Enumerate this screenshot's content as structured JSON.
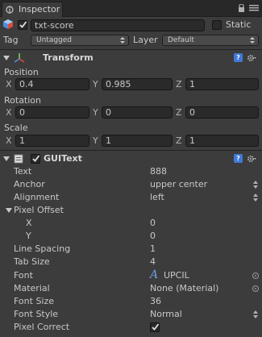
{
  "tab": {
    "title": "Inspector"
  },
  "object": {
    "name": "txt-score",
    "static_label": "Static",
    "tag_label": "Tag",
    "tag_value": "Untagged",
    "layer_label": "Layer",
    "layer_value": "Default"
  },
  "transform": {
    "title": "Transform",
    "position": {
      "label": "Position",
      "x": "0.4",
      "y": "0.985",
      "z": "1"
    },
    "rotation": {
      "label": "Rotation",
      "x": "0",
      "y": "0",
      "z": "0"
    },
    "scale": {
      "label": "Scale",
      "x": "1",
      "y": "1",
      "z": "1"
    },
    "axis_x": "X",
    "axis_y": "Y",
    "axis_z": "Z"
  },
  "guitext": {
    "title": "GUIText",
    "props": [
      {
        "label": "Text",
        "value": "888"
      },
      {
        "label": "Anchor",
        "value": "upper center"
      },
      {
        "label": "Alignment",
        "value": "left"
      },
      {
        "label": "Pixel Offset",
        "value": ""
      },
      {
        "label": "X",
        "value": "0"
      },
      {
        "label": "Y",
        "value": "0"
      },
      {
        "label": "Line Spacing",
        "value": "1"
      },
      {
        "label": "Tab Size",
        "value": "4"
      },
      {
        "label": "Font",
        "value": "UPCIL"
      },
      {
        "label": "Material",
        "value": "None (Material)"
      },
      {
        "label": "Font Size",
        "value": "36"
      },
      {
        "label": "Font Style",
        "value": "Normal"
      },
      {
        "label": "Pixel Correct",
        "value": ""
      }
    ]
  },
  "colors": {
    "panel": "#3c3c3c",
    "field": "#2a2a2a",
    "accent": "#3f7ad6"
  },
  "icons": [
    "inspector-icon",
    "lock-icon",
    "menu-icon",
    "cube-icon",
    "transform-icon",
    "gear-icon",
    "help-icon",
    "font-icon"
  ]
}
